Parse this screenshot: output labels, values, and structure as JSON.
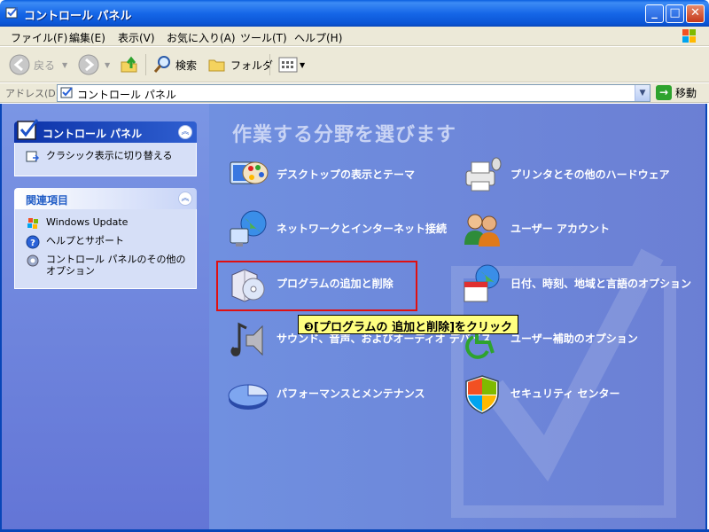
{
  "window": {
    "title": "コントロール パネル",
    "controls": {
      "minimize": "_",
      "maximize": "□",
      "close": "✕"
    }
  },
  "menubar": {
    "items": [
      "ファイル(F)",
      "編集(E)",
      "表示(V)",
      "お気に入り(A)",
      "ツール(T)",
      "ヘルプ(H)"
    ]
  },
  "toolbar": {
    "back": "戻る",
    "search": "検索",
    "folders": "フォルダ"
  },
  "address": {
    "label": "アドレス(D)",
    "value": "コントロール パネル",
    "go": "移動"
  },
  "sidebar": {
    "panel1": {
      "title": "コントロール パネル",
      "items": [
        {
          "label": "クラシック表示に切り替える",
          "icon": "switch-view-icon"
        }
      ]
    },
    "panel2": {
      "title": "関連項目",
      "items": [
        {
          "label": "Windows Update",
          "icon": "windows-update-icon"
        },
        {
          "label": "ヘルプとサポート",
          "icon": "help-icon"
        },
        {
          "label": "コントロール パネルのその他のオプション",
          "icon": "options-gear-icon"
        }
      ]
    }
  },
  "main": {
    "heading": "作業する分野を選びます",
    "categories": [
      {
        "label": "デスクトップの表示とテーマ",
        "icon": "desktop-theme-icon"
      },
      {
        "label": "プリンタとその他のハードウェア",
        "icon": "printer-icon"
      },
      {
        "label": "ネットワークとインターネット接続",
        "icon": "network-icon"
      },
      {
        "label": "ユーザー アカウント",
        "icon": "user-accounts-icon"
      },
      {
        "label": "プログラムの追加と削除",
        "icon": "add-remove-programs-icon"
      },
      {
        "label": "日付、時刻、地域と言語のオプション",
        "icon": "date-time-region-icon"
      },
      {
        "label": "サウンド、音声、およびオーディオ デバイス",
        "icon": "sound-icon"
      },
      {
        "label": "ユーザー補助のオプション",
        "icon": "accessibility-icon"
      },
      {
        "label": "パフォーマンスとメンテナンス",
        "icon": "performance-icon"
      },
      {
        "label": "セキュリティ センター",
        "icon": "security-shield-icon"
      }
    ]
  },
  "annotation": {
    "tooltip": "❸[プログラムの 追加と削除]をクリック"
  },
  "colors": {
    "titlebar": "#0a54d4",
    "sidebar_bg": "#6f86dc",
    "highlight": "#e01010",
    "tooltip_bg": "#ffff80"
  }
}
